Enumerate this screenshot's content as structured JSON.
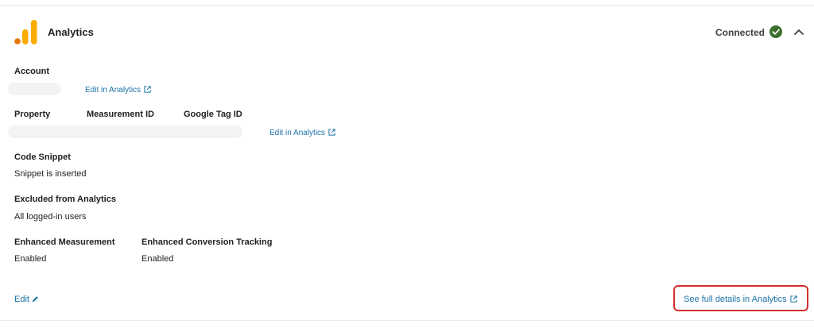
{
  "header": {
    "title": "Analytics",
    "status": "Connected",
    "logo_icon": "google-analytics-logo",
    "status_icon": "check-circle-icon",
    "collapse_icon": "chevron-up-icon"
  },
  "account": {
    "label": "Account",
    "edit_link": "Edit in Analytics"
  },
  "property": {
    "property_label": "Property",
    "measurement_label": "Measurement ID",
    "tag_label": "Google Tag ID",
    "edit_link": "Edit in Analytics"
  },
  "code_snippet": {
    "label": "Code Snippet",
    "value": "Snippet is inserted"
  },
  "excluded": {
    "label": "Excluded from Analytics",
    "value": "All logged-in users"
  },
  "enhanced_measurement": {
    "label": "Enhanced Measurement",
    "value": "Enabled"
  },
  "enhanced_conversion": {
    "label": "Enhanced Conversion Tracking",
    "value": "Enabled"
  },
  "footer": {
    "edit_label": "Edit",
    "full_details_link": "See full details in Analytics"
  },
  "colors": {
    "accent": "#1a73a8",
    "connected": "#3c6e2f",
    "highlight": "#d32f2f",
    "logo_dark": "#e37400",
    "logo_light": "#f9ab00"
  }
}
